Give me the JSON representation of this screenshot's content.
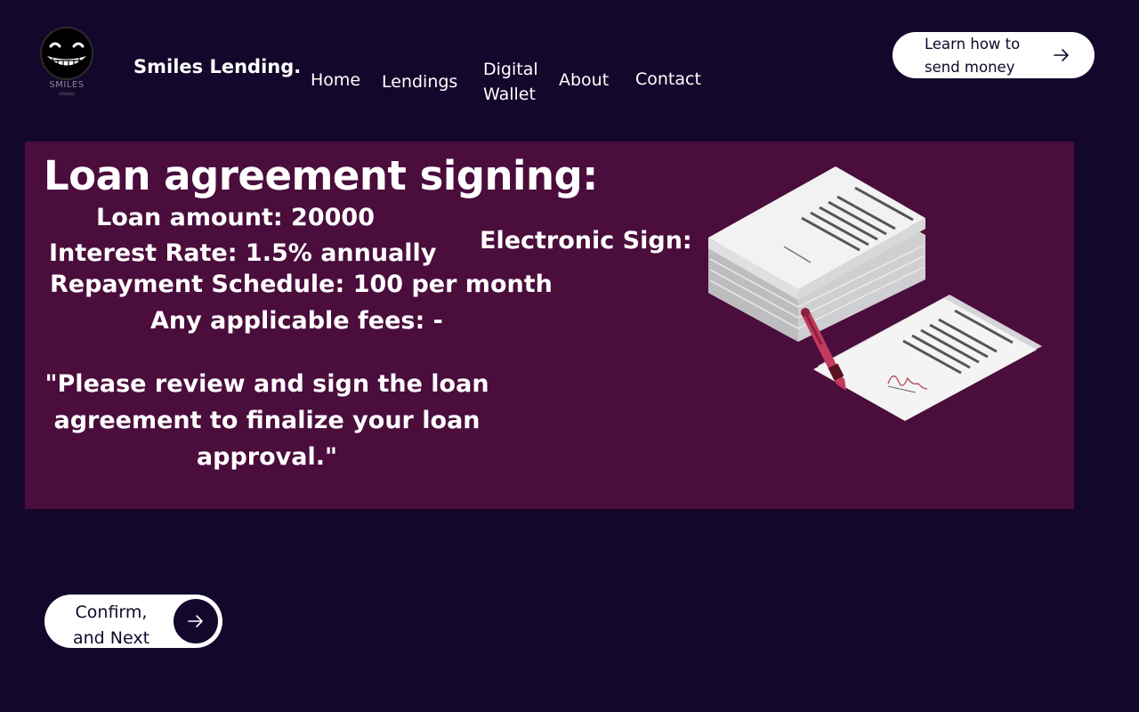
{
  "header": {
    "logo_text": "SMILES",
    "logo_subtext": "LENDING",
    "brand": "Smiles Lending.",
    "nav": [
      {
        "label": "Home"
      },
      {
        "label": "Lendings"
      },
      {
        "label": "Digital"
      },
      {
        "label": "Wallet"
      },
      {
        "label": "About"
      },
      {
        "label": "Contact"
      }
    ],
    "cta_line1": "Learn how to",
    "cta_line2": "send money",
    "cta_icon": "arrow-right-icon"
  },
  "main": {
    "heading": "Loan agreement signing:",
    "loan_amount": "Loan amount: 20000",
    "interest_rate": "Interest Rate: 1.5% annually",
    "repayment": "Repayment Schedule: 100 per month",
    "fees": "Any applicable fees: -",
    "electronic_sign_label": "Electronic Sign:",
    "quote_line1": "\"Please review and sign the loan",
    "quote_line2": "agreement to finalize your loan",
    "quote_line3": "approval.\"",
    "illustration_icon": "signed-documents-pen-illustration"
  },
  "actions": {
    "confirm_line1": "Confirm,",
    "confirm_line2": "and Next",
    "confirm_icon": "arrow-right-icon"
  },
  "colors": {
    "background": "#13072b",
    "panel": "#4a0d3c",
    "button": "#ffffff",
    "pen": "#c23a5e"
  }
}
